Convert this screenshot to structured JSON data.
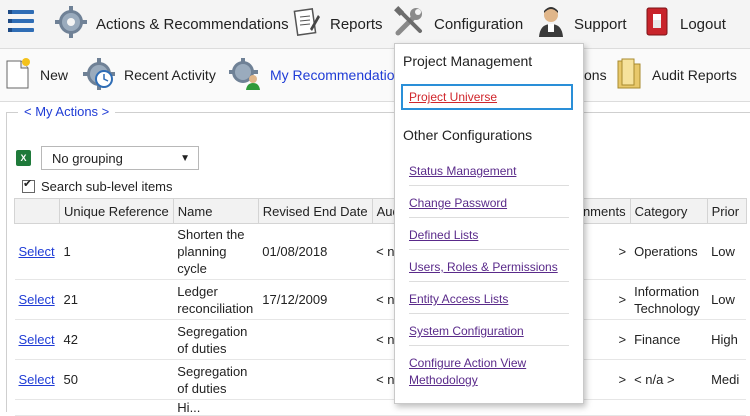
{
  "topnav": {
    "actions_label": "Actions & Recommendations",
    "reports_label": "Reports",
    "configuration_label": "Configuration",
    "support_label": "Support",
    "logout_label": "Logout"
  },
  "subnav": {
    "new_label": "New",
    "recent_label": "Recent Activity",
    "myrec_label": "My Recommendatio",
    "hidden_label": "ons",
    "audit_label": "Audit Reports"
  },
  "panel": {
    "legend": "< My Actions >",
    "grouping_value": "No grouping",
    "sublevel_label": "Search sub-level items"
  },
  "table": {
    "headers": [
      "",
      "Unique Reference",
      "Name",
      "Revised End Date",
      "Audit",
      "ssignments",
      "Category",
      "Prior"
    ],
    "rows": [
      {
        "select": "Select",
        "ref": "1",
        "name_1": "Shorten the",
        "name_2": "planning",
        "name_3": "cycle",
        "date": "01/08/2018",
        "audit": "< n/a",
        "assign": ">",
        "cat_1": "Operations",
        "cat_2": "",
        "prio": "Low"
      },
      {
        "select": "Select",
        "ref": "21",
        "name_1": "Ledger",
        "name_2": "reconciliation",
        "name_3": "",
        "date": "17/12/2009",
        "audit": "< n/a",
        "assign": ">",
        "cat_1": "Information",
        "cat_2": "Technology",
        "prio": "Low"
      },
      {
        "select": "Select",
        "ref": "42",
        "name_1": "Segregation",
        "name_2": "of duties",
        "name_3": "",
        "date": "",
        "audit": "< n/a",
        "assign": ">",
        "cat_1": "Finance",
        "cat_2": "",
        "prio": "High"
      },
      {
        "select": "Select",
        "ref": "50",
        "name_1": "Segregation",
        "name_2": "of duties",
        "name_3": "",
        "date": "",
        "audit": "< n/a",
        "assign": ">",
        "cat_1": "< n/a >",
        "cat_2": "",
        "prio": "Medi"
      }
    ],
    "partial_row_name": "Hi..."
  },
  "dropdown": {
    "project_management": "Project Management",
    "project_universe": "Project Universe",
    "other_configurations": "Other Configurations",
    "status_management": "Status Management",
    "change_password": "Change Password",
    "defined_lists": "Defined Lists",
    "users_roles": "Users, Roles & Permissions",
    "entity_access": "Entity Access Lists",
    "system_configuration": "System Configuration",
    "configure_action_view": "Configure Action View Methodology"
  },
  "colors": {
    "link_blue": "#1f3cd6",
    "visited_purple": "#5a2a8a",
    "selected_red": "#d0262c",
    "highlight_border": "#2a8fd8"
  }
}
